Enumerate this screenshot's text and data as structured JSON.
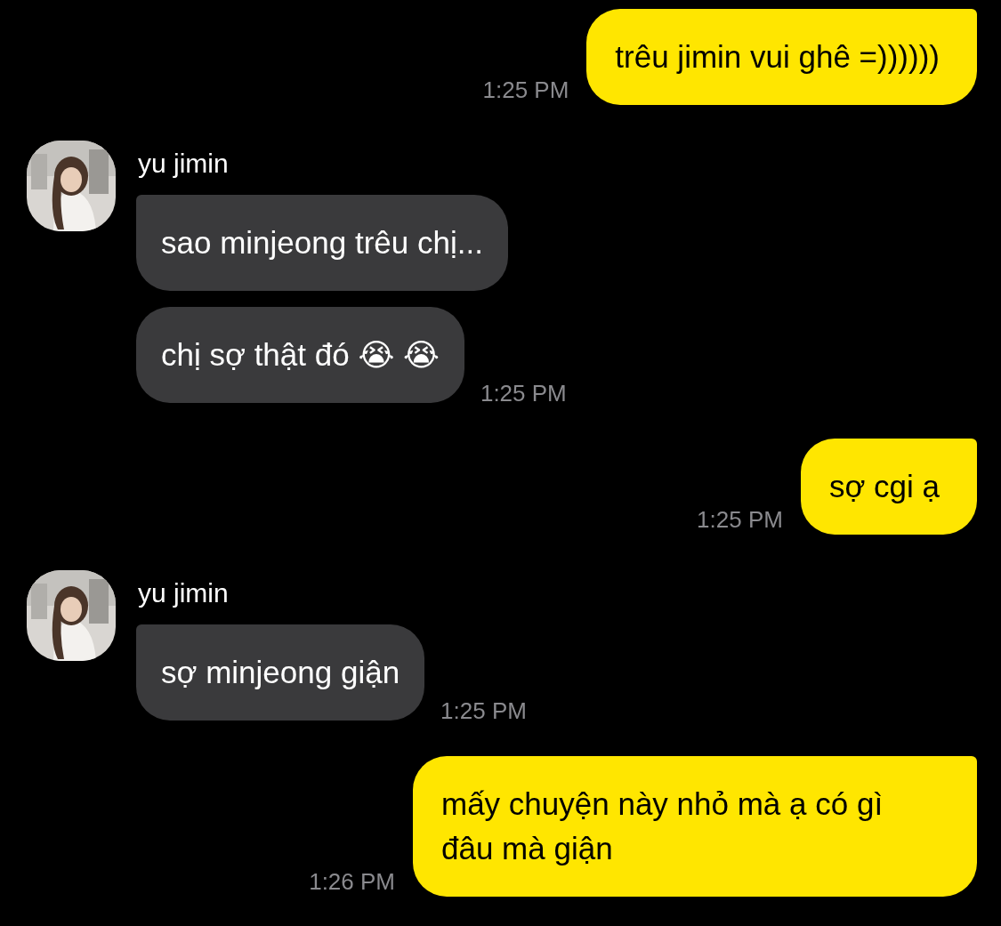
{
  "messages": [
    {
      "kind": "outgoing",
      "bubbles": [
        "trêu jimin vui ghê =))))))"
      ],
      "time": "1:25 PM"
    },
    {
      "kind": "incoming",
      "sender": "yu jimin",
      "avatar": {
        "kind": "picture"
      },
      "bubbles": [
        "sao minjeong trêu chị...",
        "chị sợ thật đó 😭 😭"
      ],
      "time": "1:25 PM"
    },
    {
      "kind": "outgoing",
      "bubbles": [
        "sợ cgi ạ"
      ],
      "time": "1:25 PM"
    },
    {
      "kind": "incoming",
      "sender": "yu jimin",
      "avatar": {
        "kind": "picture"
      },
      "bubbles": [
        "sợ minjeong giận"
      ],
      "time": "1:25 PM"
    },
    {
      "kind": "outgoing",
      "bubbles": [
        "mấy chuyện này nhỏ mà ạ có gì đâu mà giận"
      ],
      "time": "1:26 PM"
    }
  ]
}
